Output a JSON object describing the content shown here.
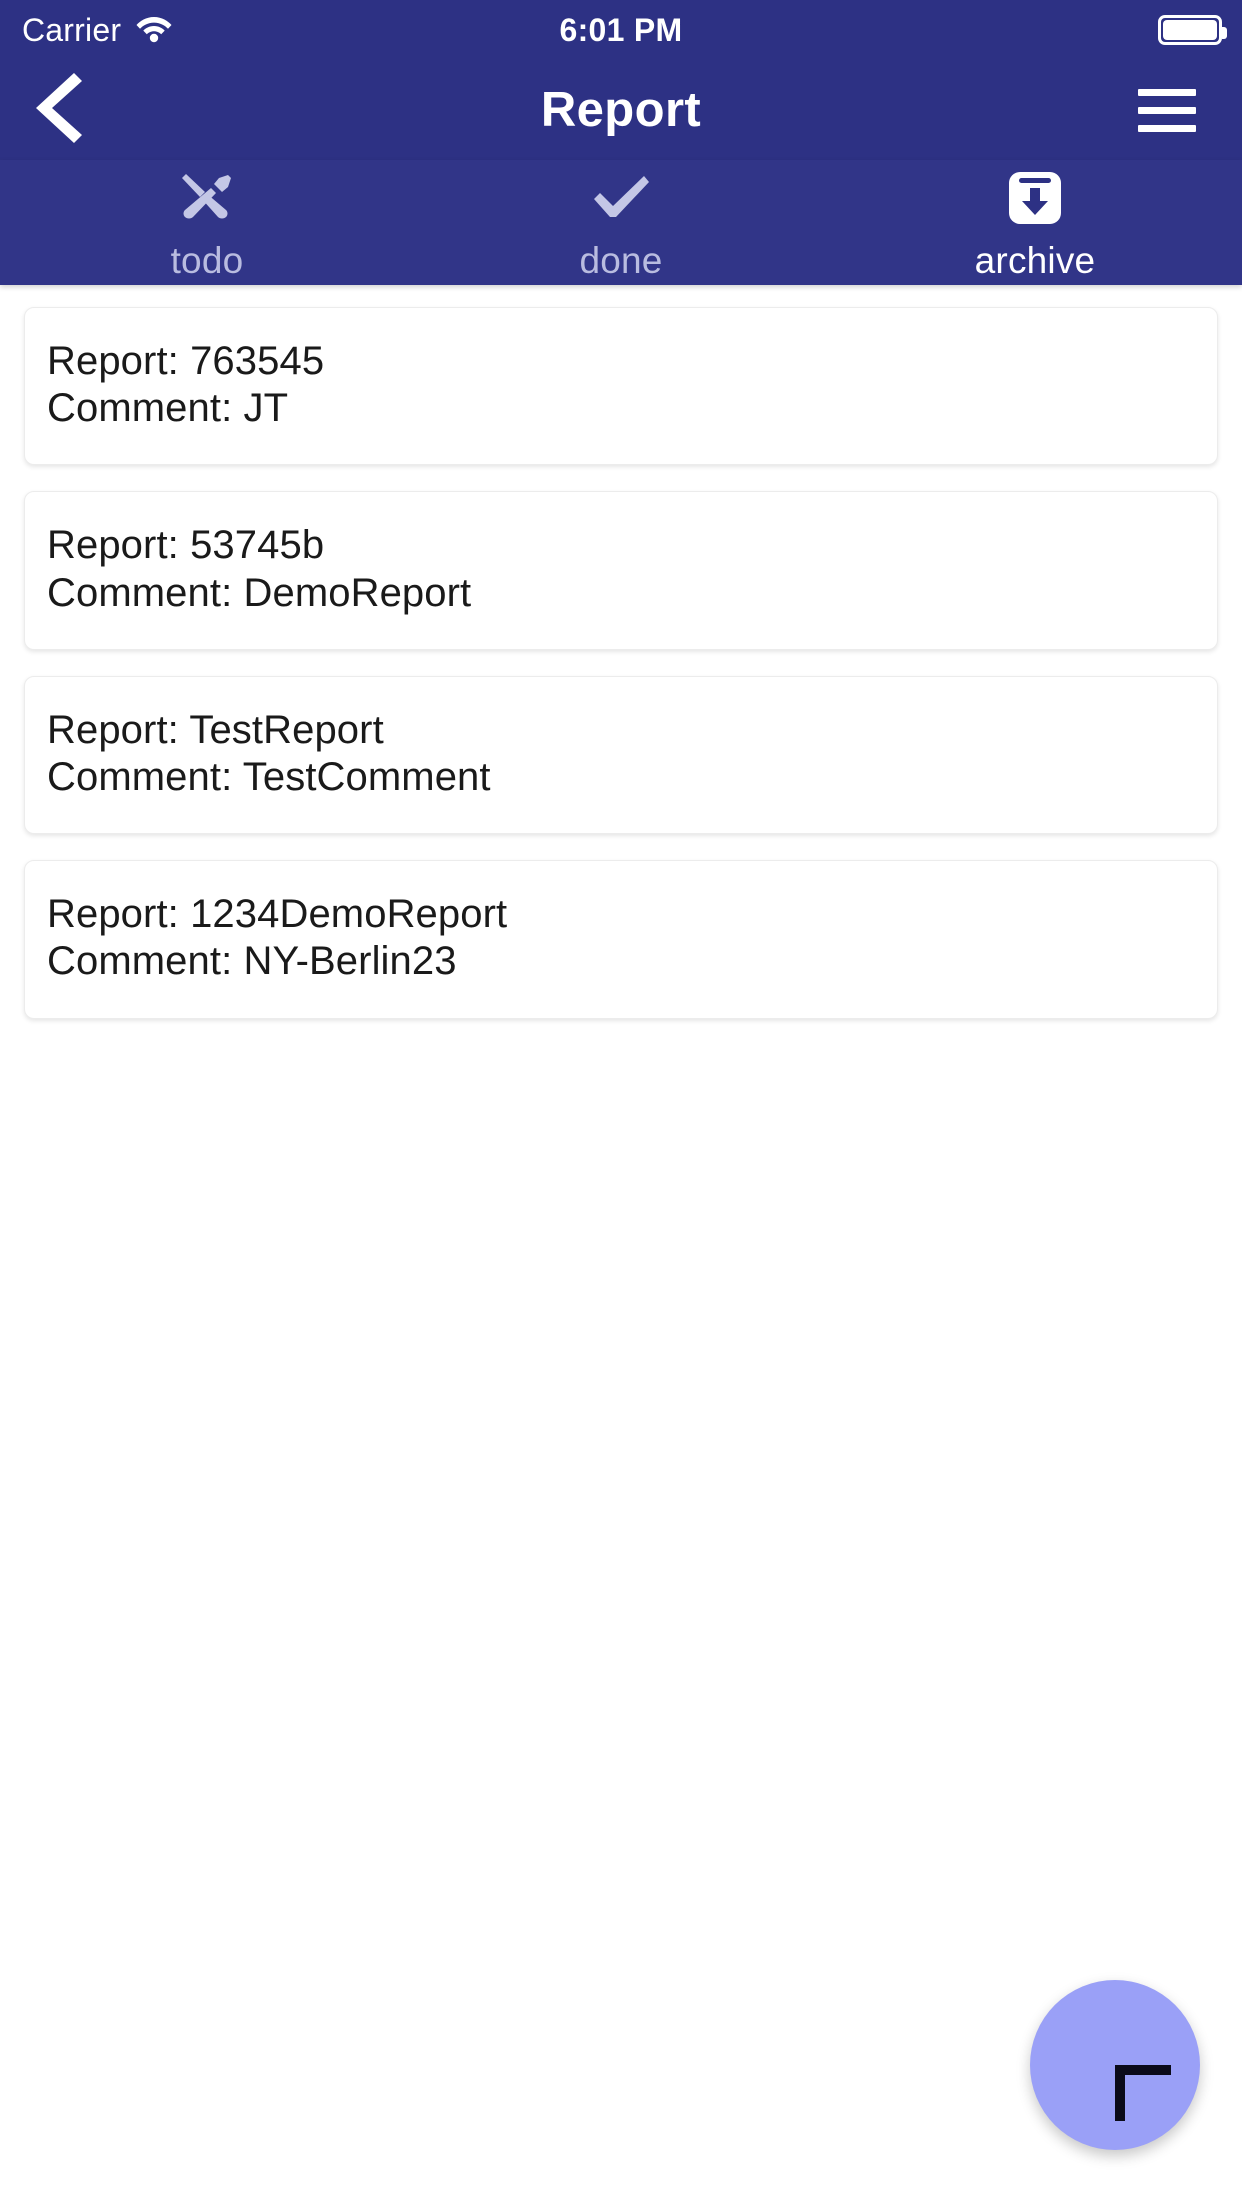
{
  "status_bar": {
    "carrier": "Carrier",
    "wifi_icon": "wifi-icon",
    "time": "6:01 PM",
    "battery_icon": "battery-full-icon"
  },
  "app_bar": {
    "back_icon": "chevron-left-icon",
    "title": "Report",
    "menu_icon": "hamburger-menu-icon"
  },
  "tabs": [
    {
      "label": "todo",
      "icon": "tools-icon",
      "active": false
    },
    {
      "label": "done",
      "icon": "checkmark-icon",
      "active": false
    },
    {
      "label": "archive",
      "icon": "archive-box-icon",
      "active": true
    }
  ],
  "list": {
    "items": [
      {
        "report_line": "Report: 763545",
        "comment_line": "Comment: JT"
      },
      {
        "report_line": "Report: 53745b",
        "comment_line": "Comment: DemoReport"
      },
      {
        "report_line": "Report: TestReport",
        "comment_line": "Comment: TestComment"
      },
      {
        "report_line": "Report: 1234DemoReport",
        "comment_line": "Comment: NY-Berlin23"
      }
    ]
  },
  "fab": {
    "icon": "plus-icon",
    "label": "+"
  },
  "colors": {
    "app_bar_background": "#2d3184",
    "tab_bar_background": "#313588",
    "tab_label_inactive": "#b9bce0",
    "tab_label_active": "#ffffff",
    "page_background": "#ffffff",
    "card_background": "#ffffff",
    "card_text": "#1a1a1a",
    "fab_background": "#9aa0f7",
    "fab_icon": "#0b0b1a"
  }
}
